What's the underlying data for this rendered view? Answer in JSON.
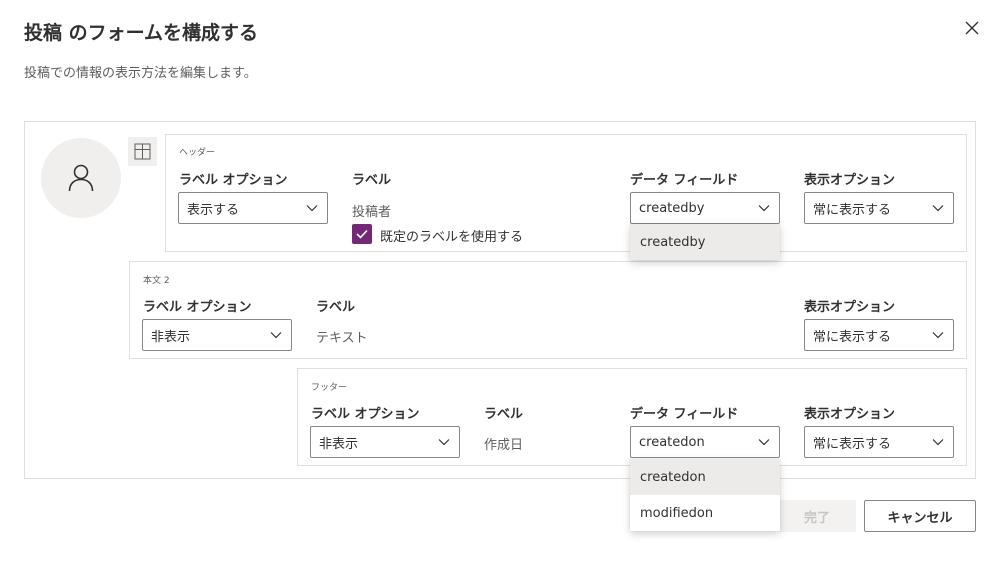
{
  "dialog": {
    "title": "投稿 のフォームを構成する",
    "subtitle": "投稿での情報の表示方法を編集します。"
  },
  "header": {
    "name": "ヘッダー",
    "label_option_title": "ラベル オプション",
    "label_option_value": "表示する",
    "label_title": "ラベル",
    "label_value": "投稿者",
    "checkbox_label": "既定のラベルを使用する",
    "checkbox_checked": true,
    "data_field_title": "データ フィールド",
    "data_field_value": "createdby",
    "data_field_options": [
      "createdby"
    ],
    "display_option_title": "表示オプション",
    "display_option_value": "常に表示する"
  },
  "body": {
    "name": "本文 2",
    "label_option_title": "ラベル オプション",
    "label_option_value": "非表示",
    "label_title": "ラベル",
    "label_value": "テキスト",
    "display_option_title": "表示オプション",
    "display_option_value": "常に表示する"
  },
  "footer": {
    "name": "フッター",
    "label_option_title": "ラベル オプション",
    "label_option_value": "非表示",
    "label_title": "ラベル",
    "label_value": "作成日",
    "data_field_title": "データ フィールド",
    "data_field_value": "createdon",
    "data_field_options": [
      "createdon",
      "modifiedon"
    ],
    "display_option_title": "表示オプション",
    "display_option_value": "常に表示する"
  },
  "buttons": {
    "done": "完了",
    "cancel": "キャンセル"
  },
  "colors": {
    "accent": "#742774",
    "border": "#e1dfdd",
    "disabled_text": "#c8c6c4"
  },
  "icons": {
    "close": "close-icon",
    "avatar": "person-icon",
    "layout": "layout-icon",
    "chevron": "chevron-down-icon",
    "check": "checkmark-icon"
  }
}
